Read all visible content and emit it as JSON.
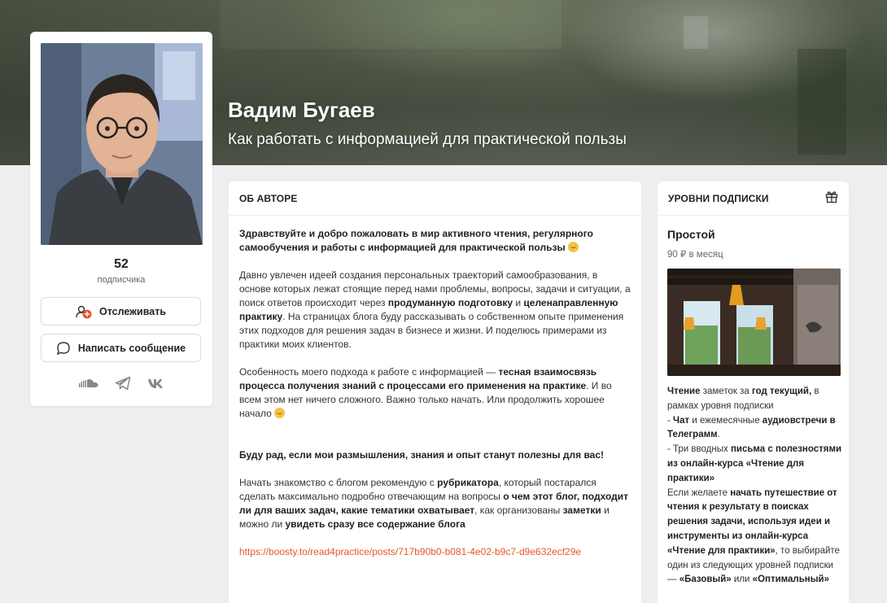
{
  "banner": {
    "title": "Вадим Бугаев",
    "subtitle": "Как работать с информацией для практической пользы"
  },
  "profile": {
    "subscribers_count": "52",
    "subscribers_label": "подписчика",
    "follow_label": "Отслеживать",
    "message_label": "Написать сообщение",
    "socials": [
      "soundcloud-icon",
      "telegram-icon",
      "vk-icon"
    ]
  },
  "about": {
    "heading": "ОБ АВТОРЕ",
    "intro": "Здравствуйте и добро пожаловать в мир активного чтения, регулярного самообучения и работы с информацией для практической пользы",
    "p2_part1": "Давно увлечен идеей создания персональных траекторий самообразования, в основе которых лежат стоящие перед нами проблемы, вопросы, задачи и ситуации, а поиск ответов происходит через ",
    "p2_bold1": "продуманную подготовку",
    "p2_part2": " и ",
    "p2_bold2": "целенаправленную практику",
    "p2_part3": ". На страницах блога буду рассказывать о собственном опыте применения этих подходов для решения задач в бизнесе и жизни. И поделюсь примерами из практики моих клиентов.",
    "p3_part1": "Особенность моего подхода к работе с информацией — ",
    "p3_bold": "тесная взаимосвязь процесса получения знаний с процессами его применения на практике",
    "p3_part2": ". И во всем этом нет ничего сложного. Важно только начать. Или продолжить хорошее начало",
    "p4_bold": "Буду рад, если мои размышления, знания и опыт станут полезны для вас!",
    "p5_part1": "Начать знакомство с блогом рекомендую с ",
    "p5_bold1": "рубрикатора",
    "p5_part2": ", который постарался сделать максимально подробно отвечающим на вопросы ",
    "p5_bold2": "о чем этот блог, подходит ли для ваших задач, какие тематики охватывает",
    "p5_part3": ", как организованы ",
    "p5_bold3": "заметки",
    "p5_part4": " и можно ли ",
    "p5_bold4": "увидеть сразу все содержание блога",
    "link": "https://boosty.to/read4practice/posts/717b90b0-b081-4e02-b9c7-d9e632ecf29e"
  },
  "tiers": {
    "heading": "УРОВНИ ПОДПИСКИ",
    "name": "Простой",
    "price": "90 ₽ в месяц",
    "d_b1": "Чтение",
    "d_t1": " заметок за ",
    "d_b2": "год текущий,",
    "d_t2": " в рамках уровня подписки",
    "d_t3": "- ",
    "d_b3": "Чат",
    "d_t4": " и ежемесячные ",
    "d_b4": "аудиовстречи в Телеграмм",
    "d_t5": ".",
    "d_t6": "- Три вводных ",
    "d_b5": "письма с полезностями из онлайн-курса «Чтение для практики»",
    "d_t7": "Если желаете ",
    "d_b6": "начать путешествие от чтения к результату в поисках решения задачи, используя идеи и инструменты из онлайн-курса «Чтение для практики»",
    "d_t8": ", то выбирайте один из следующих уровней подписки — ",
    "d_b7": "«Базовый»",
    "d_t9": " или ",
    "d_b8": "«Оптимальный»"
  },
  "colors": {
    "accent": "#e8572a",
    "page_bg": "#eeeeee"
  }
}
